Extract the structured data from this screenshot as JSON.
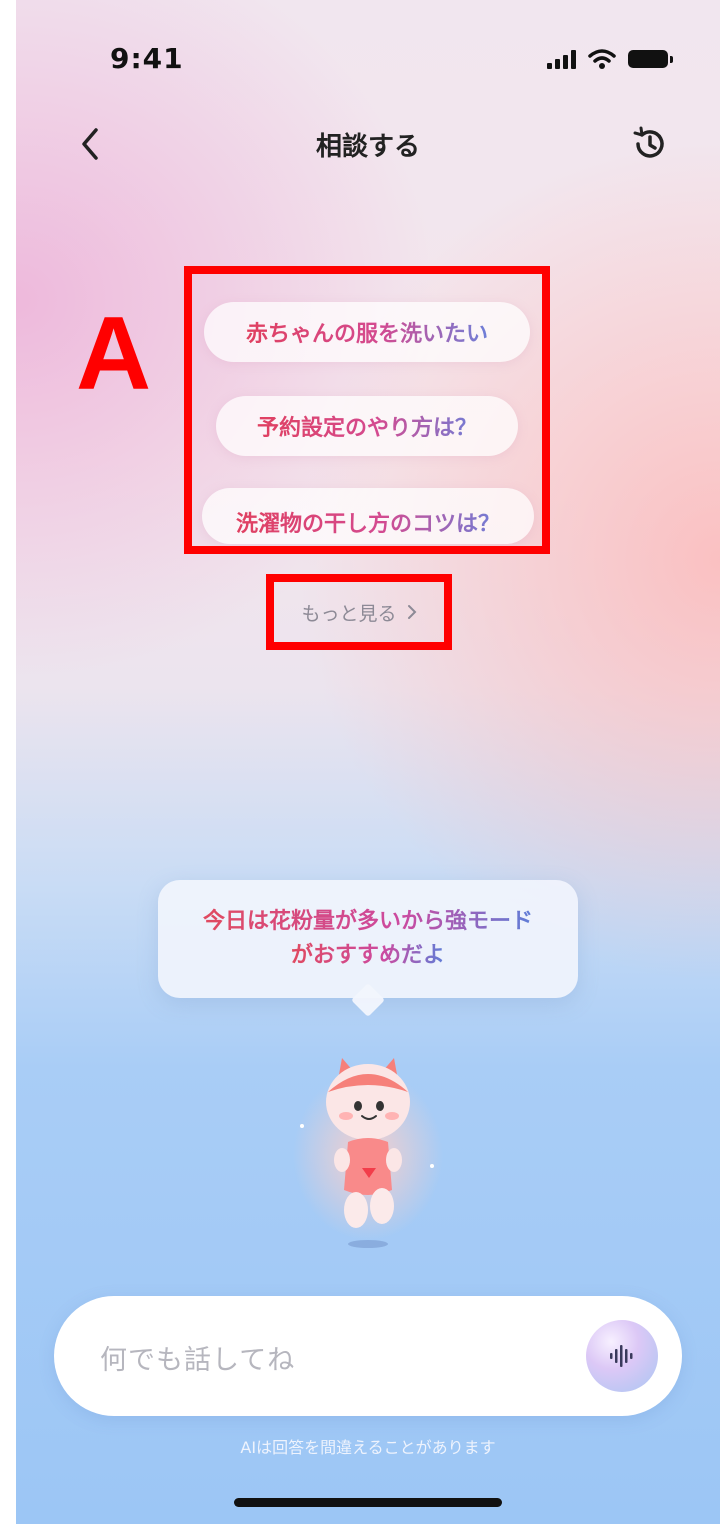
{
  "status_bar": {
    "time": "9:41"
  },
  "header": {
    "title": "相談する"
  },
  "annotation": {
    "label": "A"
  },
  "suggestions": {
    "items": [
      {
        "label": "赤ちゃんの服を洗いたい"
      },
      {
        "label": "予約設定のやり方は？"
      },
      {
        "label": "洗濯物の干し方のコツは？"
      }
    ],
    "more_label": "もっと見る"
  },
  "bubble": {
    "line1": "今日は花粉量が多いから強モード",
    "line2": "がおすすめだよ"
  },
  "input": {
    "placeholder": "何でも話してね"
  },
  "disclaimer": "AIは回答を間違えることがあります",
  "colors": {
    "annotation_red": "#ff0000",
    "gradient_start": "#e04060",
    "gradient_end": "#6e7fd8"
  }
}
